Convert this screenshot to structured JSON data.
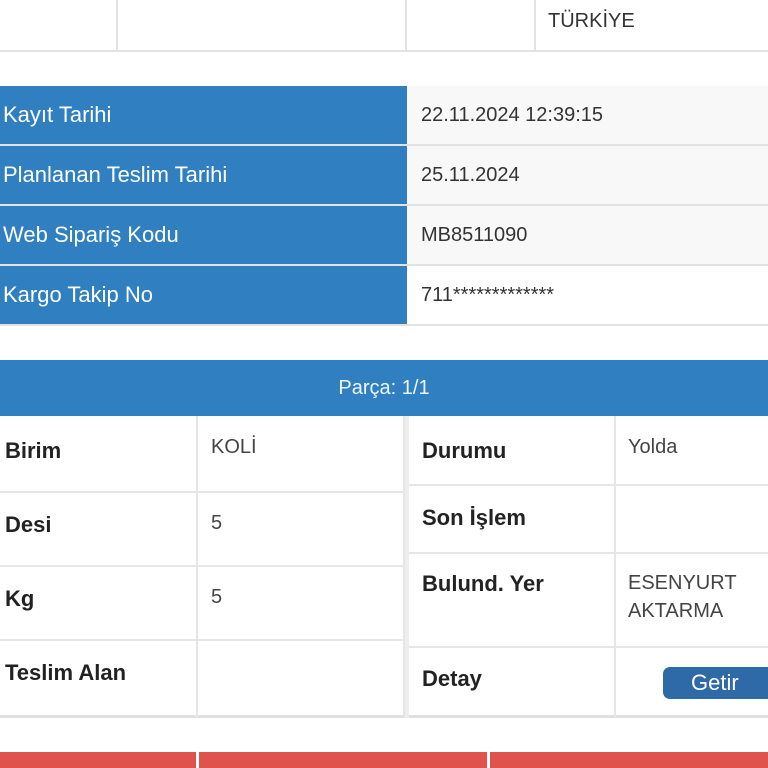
{
  "top": {
    "country": "TÜRKİYE"
  },
  "info": {
    "rows": [
      {
        "label": "Kayıt Tarihi",
        "value": "22.11.2024 12:39:15"
      },
      {
        "label": "Planlanan Teslim Tarihi",
        "value": "25.11.2024"
      },
      {
        "label": "Web Sipariş Kodu",
        "value": "MB8511090"
      },
      {
        "label": "Kargo Takip No",
        "value": "711*************"
      }
    ]
  },
  "parca": {
    "title": "Parça: 1/1"
  },
  "parts": {
    "left": [
      {
        "label": "Birim",
        "value": "KOLİ"
      },
      {
        "label": "Desi",
        "value": "5"
      },
      {
        "label": "Kg",
        "value": "5"
      },
      {
        "label": "Teslim Alan",
        "value": ""
      }
    ],
    "right": [
      {
        "label": "Durumu",
        "value": "Yolda"
      },
      {
        "label": "Son İşlem",
        "value": ""
      },
      {
        "label": "Bulund. Yer",
        "value": "ESENYURT AKTARMA"
      },
      {
        "label": "Detay",
        "button": "Getir"
      }
    ]
  },
  "colors": {
    "header_blue": "#2f7fc1",
    "button_blue": "#2f6aa8",
    "footer_red": "#e0534d"
  }
}
